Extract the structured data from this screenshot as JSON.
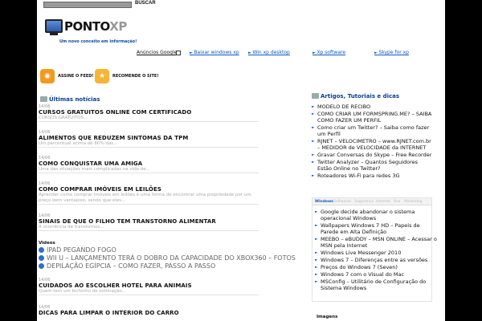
{
  "header": {
    "search_button": "BUSCAR",
    "logo_main": "PONTO",
    "logo_accent": "XP",
    "tagline": "Um novo conceito em informação!"
  },
  "ads": {
    "label": "Anúncios Google",
    "links": [
      "Baixar windows xp",
      "Win xp desktop",
      "Xp software",
      "Skype for xp"
    ]
  },
  "feeds": {
    "rss_label": "ASSINE O FEED!",
    "recommend_label": "RECOMENDE O SITE!"
  },
  "left": {
    "heading": "Últimas notícias",
    "posts": [
      {
        "date": "14/06",
        "title": "CURSOS GRATUITOS ONLINE COM CERTIFICADO",
        "excerpt": "CURSOS GRATUITOS..."
      },
      {
        "date": "14/06",
        "title": "ALIMENTOS QUE REDUZEM SINTOMAS DA TPM",
        "excerpt": "Um percentual acima de 80% das..."
      },
      {
        "date": "14/06",
        "title": "COMO CONQUISTAR UMA AMIGA",
        "excerpt": "Uma das situações mais complicadas na vida de..."
      },
      {
        "date": "14/06",
        "title": "COMO COMPRAR IMÓVEIS EM LEILÕES",
        "excerpt": "Aprender como comprar imóveis em leilões é uma forma de encontrar uma propriedade por um preço bem vantajoso, sendo que eles..."
      },
      {
        "date": "14/06",
        "title": "SINAIS DE QUE O FILHO TEM TRANSTORNO ALIMENTAR",
        "excerpt": "A ocorrência de transtornos..."
      }
    ],
    "videos_heading": "Videos",
    "videos": [
      "IPAD PEGANDO FOGO",
      "WII U – LANÇAMENTO TERÁ O DOBRO DA CAPACIDADE DO XBOX360 – FOTOS",
      "DEPILAÇÃO EGÍPCIA – COMO FAZER, PASSO A PASSO"
    ],
    "posts_after": [
      {
        "date": "14/06",
        "title": "CUIDADOS AO ESCOLHER HOTEL PARA ANIMAIS",
        "excerpt": "Quem tem um bichinho de estimação..."
      },
      {
        "date": "14/06",
        "title": "DICAS PARA LIMPAR O INTERIOR DO CARRO",
        "excerpt": ""
      }
    ]
  },
  "right": {
    "heading": "Artigos, Tutoriais e dicas",
    "articles": [
      "MODELO DE RECIBO",
      "COMO CRIAR UM FORMSPRING.ME? – SAIBA COMO FAZER UM PERFIL",
      "Como criar um Twitter? – Saiba como fazer um Perfil",
      "RJNET – VELOCIMETRO – www.RJNET.com.br – MEDIDOR de VELOCIDADE da INTERNET",
      "Gravar Conversas do Skype – Free Recorder",
      "Twitter Analyzer – Quantos Seguidores Estão Online no Twitter?",
      "Roteadores Wi-Fi para redes 3G"
    ],
    "tabs": [
      "Windows",
      "Softwares",
      "Segurança",
      "Internet",
      "Seo",
      "Marketing"
    ],
    "windows_items": [
      "Google decide abandonar o sistema operacional Windows",
      "Wallpapers Windows 7 HD – Papeis de Parede em Alta Definição",
      "MEEBO – eBUDDY – MSN ONLINE – Acessar o MSN pela Internet",
      "Windows Live Messenger 2010",
      "Windows 7 – Diferenças entre as versões",
      "Preços do Windows 7 (Seven)",
      "Windows 7 com o Visual do Mac",
      "MSConfig – Utilitário de Configuração do Sistema Windows"
    ],
    "images_heading": "Imagens"
  },
  "colors": {
    "accent": "#0b57c4",
    "heading": "#0b3d91",
    "rss": "#f29a1d"
  }
}
